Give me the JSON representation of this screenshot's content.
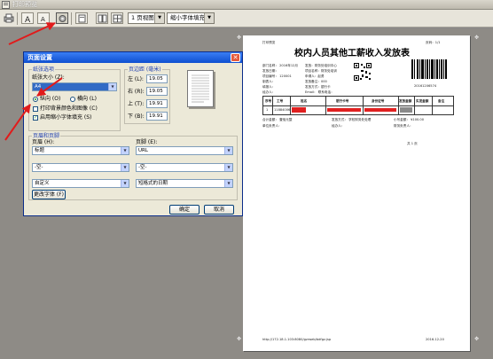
{
  "window": {
    "title": "打印预览"
  },
  "toolbar": {
    "buttons": [
      {
        "name": "print-icon"
      },
      {
        "name": "text-size-a-icon"
      },
      {
        "name": "text-size-a-small-icon"
      },
      {
        "name": "page-setup-gear-icon"
      },
      {
        "name": "single-page-icon"
      },
      {
        "name": "two-page-icon"
      },
      {
        "name": "multi-page-icon"
      }
    ],
    "view_select": "1 页视图",
    "zoom_select": "缩小字体填充"
  },
  "dialog": {
    "title": "页面设置",
    "paper_group": "纸张选项",
    "paper_size_label": "纸张大小 (Z):",
    "paper_size_value": "A4",
    "portrait_label": "纵向 (O)",
    "landscape_label": "横向 (L)",
    "print_bg_label": "打印背景颜色和图像 (C)",
    "shrink_label": "启用缩小字体填充 (S)",
    "margins_group": "页边距 (毫米)",
    "margins": [
      {
        "label": "左 (L):",
        "value": "19.05"
      },
      {
        "label": "右 (R):",
        "value": "19.05"
      },
      {
        "label": "上 (T):",
        "value": "19.91"
      },
      {
        "label": "下 (B):",
        "value": "19.91"
      }
    ],
    "header_footer_group": "页眉和页脚",
    "header_label": "页眉 (H):",
    "footer_label": "页脚 (E):",
    "header_left": "标题",
    "header_center": "-空-",
    "header_right": "自定义",
    "footer_left": "URL",
    "footer_center": "-空-",
    "footer_right": "短格式的日期",
    "change_font_button": "更改字体 (F)",
    "ok_button": "确定",
    "cancel_button": "取消",
    "portrait_selected": true,
    "print_bg_checked": false,
    "shrink_checked": true
  },
  "preview": {
    "header_left": "打印预览",
    "header_right": "页码：1/1",
    "doc_title": "校内人员其他工薪收入发放表",
    "info_rows": [
      [
        "部门名称：",
        "2016年12月",
        "发放：财务处培训中心"
      ],
      [
        "发放日期：",
        "",
        "项目名称：财务处培训"
      ],
      [
        "项目编号：",
        "120001",
        "申请人：赵勇"
      ],
      [
        "制表人：",
        "",
        "发放备注：000"
      ],
      [
        "填报人：",
        "",
        "发放方式：银行卡"
      ],
      [
        "经办人：",
        "",
        "Email：",
        "联系电话："
      ]
    ],
    "qr_code_caption": "20161206574",
    "table_headers": [
      "序号",
      "工号",
      "姓名",
      "银行卡号",
      "身份证号",
      "发放金额",
      "实发金额",
      "备注"
    ],
    "table_row": [
      "1",
      "11884006",
      "",
      "",
      "",
      "",
      "",
      ""
    ],
    "summary_lines": [
      [
        "合计金额：",
        "壹佰元整",
        "发放方式：",
        "学校财务处处理",
        "小写金额：",
        "¥100.00"
      ],
      [
        "单位负责人：",
        "",
        "经办人：",
        "",
        "财务负责人：",
        ""
      ]
    ],
    "page_number": "共 1 页",
    "footer_url": "http://172.18.1.103:8080/gzrweb/bdfgz.jsp",
    "footer_date": "2016-12-20"
  },
  "colors": {
    "dialog_title_bar": "#0e4fd0",
    "annotation_red": "#e11b1b",
    "workspace_bg": "#8e8b86"
  }
}
